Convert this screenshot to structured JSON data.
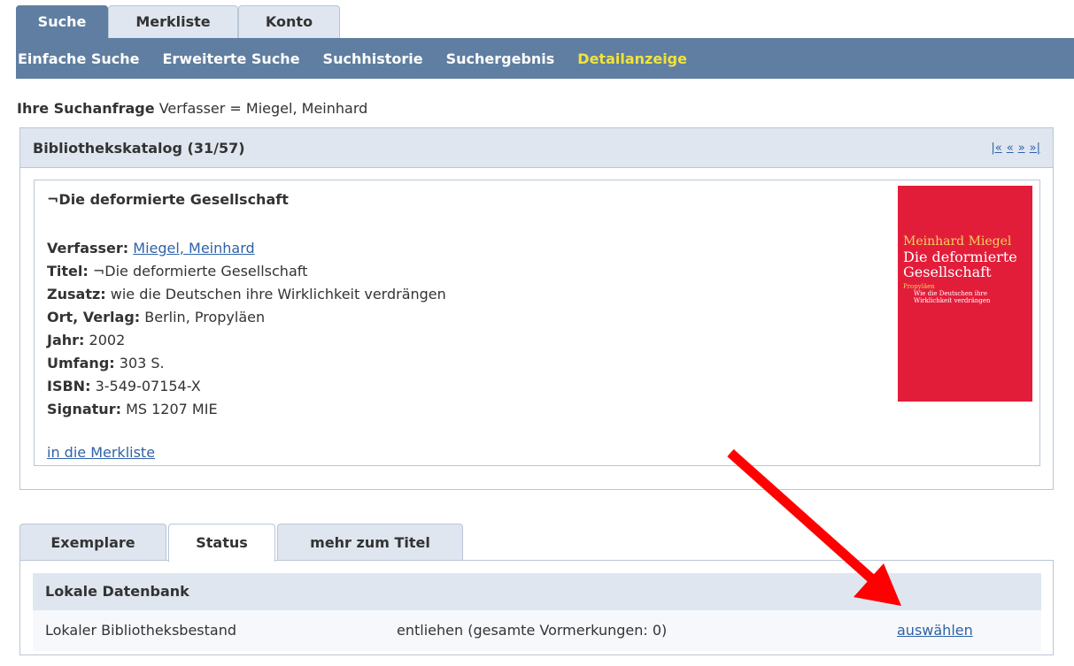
{
  "top_tabs": [
    "Suche",
    "Merkliste",
    "Konto"
  ],
  "subnav": [
    "Einfache Suche",
    "Erweiterte Suche",
    "Suchhistorie",
    "Suchergebnis",
    "Detailanzeige"
  ],
  "query": {
    "label": "Ihre Suchanfrage",
    "value": "Verfasser = Miegel, Meinhard"
  },
  "catalog": {
    "title": "Bibliothekskatalog (31/57)",
    "pager": {
      "first": "|«",
      "prev": "«",
      "next": "»",
      "last": "»|"
    }
  },
  "record": {
    "title": "¬Die deformierte Gesellschaft",
    "fields": [
      {
        "label": "Verfasser:",
        "value": "Miegel, Meinhard"
      },
      {
        "label": "Titel:",
        "value": "¬Die deformierte Gesellschaft"
      },
      {
        "label": "Zusatz:",
        "value": "wie die Deutschen ihre Wirklichkeit verdrängen"
      },
      {
        "label": "Ort, Verlag:",
        "value": "Berlin, Propyläen"
      },
      {
        "label": "Jahr:",
        "value": "2002"
      },
      {
        "label": "Umfang:",
        "value": "303 S."
      },
      {
        "label": "ISBN:",
        "value": "3-549-07154-X"
      },
      {
        "label": "Signatur:",
        "value": "MS 1207 MIE"
      }
    ],
    "merkliste_link": "in die Merkliste"
  },
  "cover": {
    "author": "Meinhard Miegel",
    "title_line1": "Die deformierte",
    "title_line2": "Gesellschaft",
    "publisher": "Propyläen",
    "subtitle_line1": "Wie die Deutschen ihre",
    "subtitle_line2": "Wirklichkeit verdrängen",
    "background_color": "#e21d3a"
  },
  "bottom_tabs": [
    "Exemplare",
    "Status",
    "mehr zum Titel"
  ],
  "status": {
    "db_title": "Lokale Datenbank",
    "row": {
      "name": "Lokaler Bibliotheksbestand",
      "state": "entliehen (gesamte Vormerkungen: 0)",
      "action": "auswählen"
    }
  },
  "colors": {
    "nav": "#5f7ea1",
    "active_subnav": "#f2e33a",
    "link": "#2f62a8",
    "arrow": "#ff0000"
  }
}
